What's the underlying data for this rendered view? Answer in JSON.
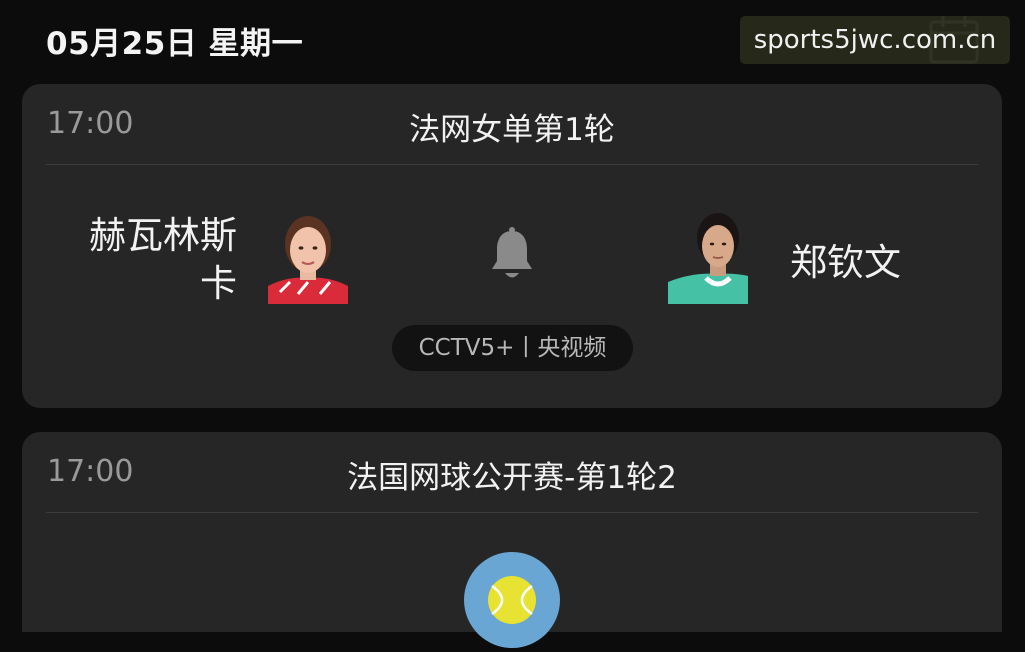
{
  "header": {
    "date": "05月25日 星期一",
    "calendar_icon": "calendar-icon"
  },
  "watermark": "sports5jwc.com.cn",
  "matches": [
    {
      "time": "17:00",
      "title": "法网女单第1轮",
      "home": {
        "name": "赫瓦林斯卡"
      },
      "away": {
        "name": "郑钦文"
      },
      "reminder_icon": "bell-icon",
      "channels": "CCTV5+丨央视频"
    },
    {
      "time": "17:00",
      "title": "法国网球公开赛-第1轮2",
      "logo_icon": "tennis-ball-icon"
    }
  ],
  "colors": {
    "background": "#0c0c0c",
    "card": "#262626",
    "pill": "#121212",
    "tennis_ball": "#e8e233",
    "logo_circle": "#6aa6d4"
  }
}
